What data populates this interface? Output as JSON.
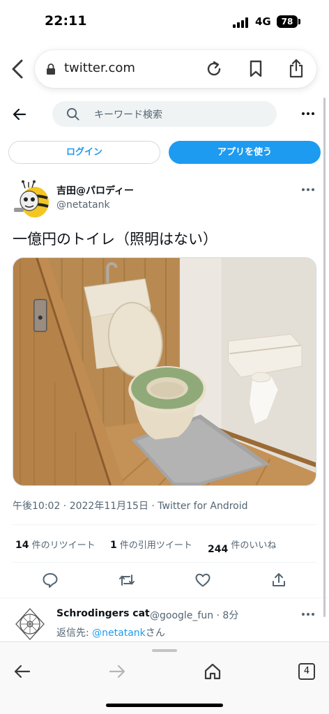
{
  "status_bar": {
    "time": "22:11",
    "network": "4G",
    "battery": "78"
  },
  "browser": {
    "url": "twitter.com",
    "tab_count": "4"
  },
  "header": {
    "search_placeholder": "キーワード検索",
    "login_label": "ログイン",
    "app_label": "アプリを使う"
  },
  "tweet": {
    "display_name": "吉田@パロディー",
    "handle": "@netatank",
    "text": "一億円のトイレ（照明はない）",
    "meta": "午後10:02 · 2022年11月15日 · Twitter for Android",
    "stats": {
      "retweets_count": "14",
      "retweets_label": "件のリツイート",
      "quotes_count": "1",
      "quotes_label": "件の引用ツイート",
      "likes_count": "244",
      "likes_label": "件のいいね"
    }
  },
  "reply": {
    "name": "Schrodingers cat",
    "handle_time": "@google_fun · 8分",
    "to_prefix": "返信先: ",
    "to_link": "@netatank",
    "to_suffix": "さん"
  },
  "colors": {
    "accent": "#1d9bf0",
    "text": "#0f1419",
    "muted": "#536471"
  },
  "icons": [
    "chevron-left-icon",
    "lock-icon",
    "reload-icon",
    "bookmark-icon",
    "share-icon",
    "search-icon",
    "more-icon",
    "reply-icon",
    "retweet-icon",
    "like-icon",
    "home-icon",
    "tabs-icon"
  ]
}
